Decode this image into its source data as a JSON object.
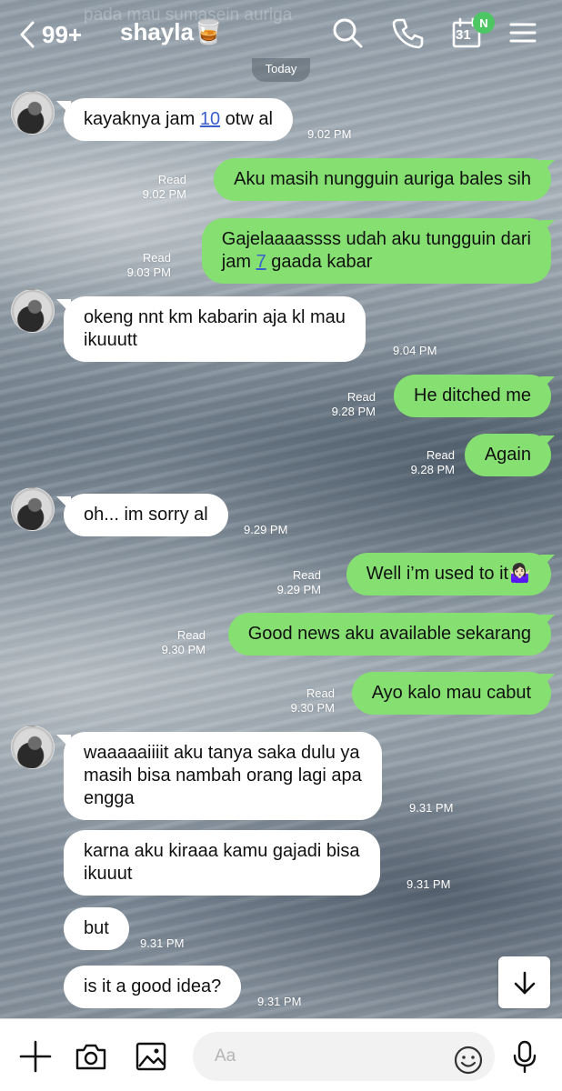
{
  "header": {
    "preview_text": "pada mau sumasein auriga",
    "back_count": "99+",
    "contact_name": "shayla🥃",
    "calendar_day": "31",
    "new_badge": "N",
    "icons": [
      "chevron-left-icon",
      "search-icon",
      "phone-icon",
      "calendar-icon",
      "menu-icon"
    ]
  },
  "date_divider": "Today",
  "messages": [
    {
      "dir": "in",
      "text_a": "kayaknya jam ",
      "link": "10",
      "text_b": " otw al",
      "time": "9.02 PM"
    },
    {
      "dir": "out",
      "read": "Read",
      "text": "Aku masih nungguin auriga bales sih",
      "time": "9.02 PM"
    },
    {
      "dir": "out",
      "read": "Read",
      "line1": "Gajelaaaassss udah aku tungguin dari",
      "line2_a": "jam ",
      "link": "7",
      "line2_b": " gaada kabar",
      "time": "9.03 PM"
    },
    {
      "dir": "in",
      "line1": "okeng nnt km kabarin aja kl mau",
      "line2": "ikuuutt",
      "time": "9.04 PM"
    },
    {
      "dir": "out",
      "read": "Read",
      "text": "He ditched me",
      "time": "9.28 PM"
    },
    {
      "dir": "out",
      "read": "Read",
      "text": "Again",
      "time": "9.28 PM"
    },
    {
      "dir": "in",
      "text": "oh... im sorry al",
      "time": "9.29 PM"
    },
    {
      "dir": "out",
      "read": "Read",
      "text": "Well i’m used to it🤷🏻‍♀️",
      "time": "9.29 PM"
    },
    {
      "dir": "out",
      "read": "Read",
      "text": "Good news aku available sekarang",
      "time": "9.30 PM"
    },
    {
      "dir": "out",
      "read": "Read",
      "text": "Ayo kalo mau cabut",
      "time": "9.30 PM"
    },
    {
      "dir": "in",
      "line1": "waaaaaiiiit aku tanya saka dulu ya",
      "line2": "masih bisa nambah orang lagi apa",
      "line3": "engga",
      "time": "9.31 PM"
    },
    {
      "dir": "in",
      "line1": "karna aku kiraaa kamu gajadi bisa",
      "line2": "ikuuut",
      "time": "9.31 PM"
    },
    {
      "dir": "in",
      "text": "but",
      "time": "9.31 PM"
    },
    {
      "dir": "in",
      "text": "is it a good idea?",
      "time": "9.31 PM"
    }
  ],
  "composer": {
    "placeholder": "Aa",
    "icons": [
      "plus-icon",
      "camera-icon",
      "image-icon",
      "emoji-icon",
      "microphone-icon"
    ]
  },
  "colors": {
    "incoming_bubble": "#ffffff",
    "outgoing_bubble": "#85e071",
    "badge": "#4cc764",
    "link": "#3a5fcd"
  }
}
